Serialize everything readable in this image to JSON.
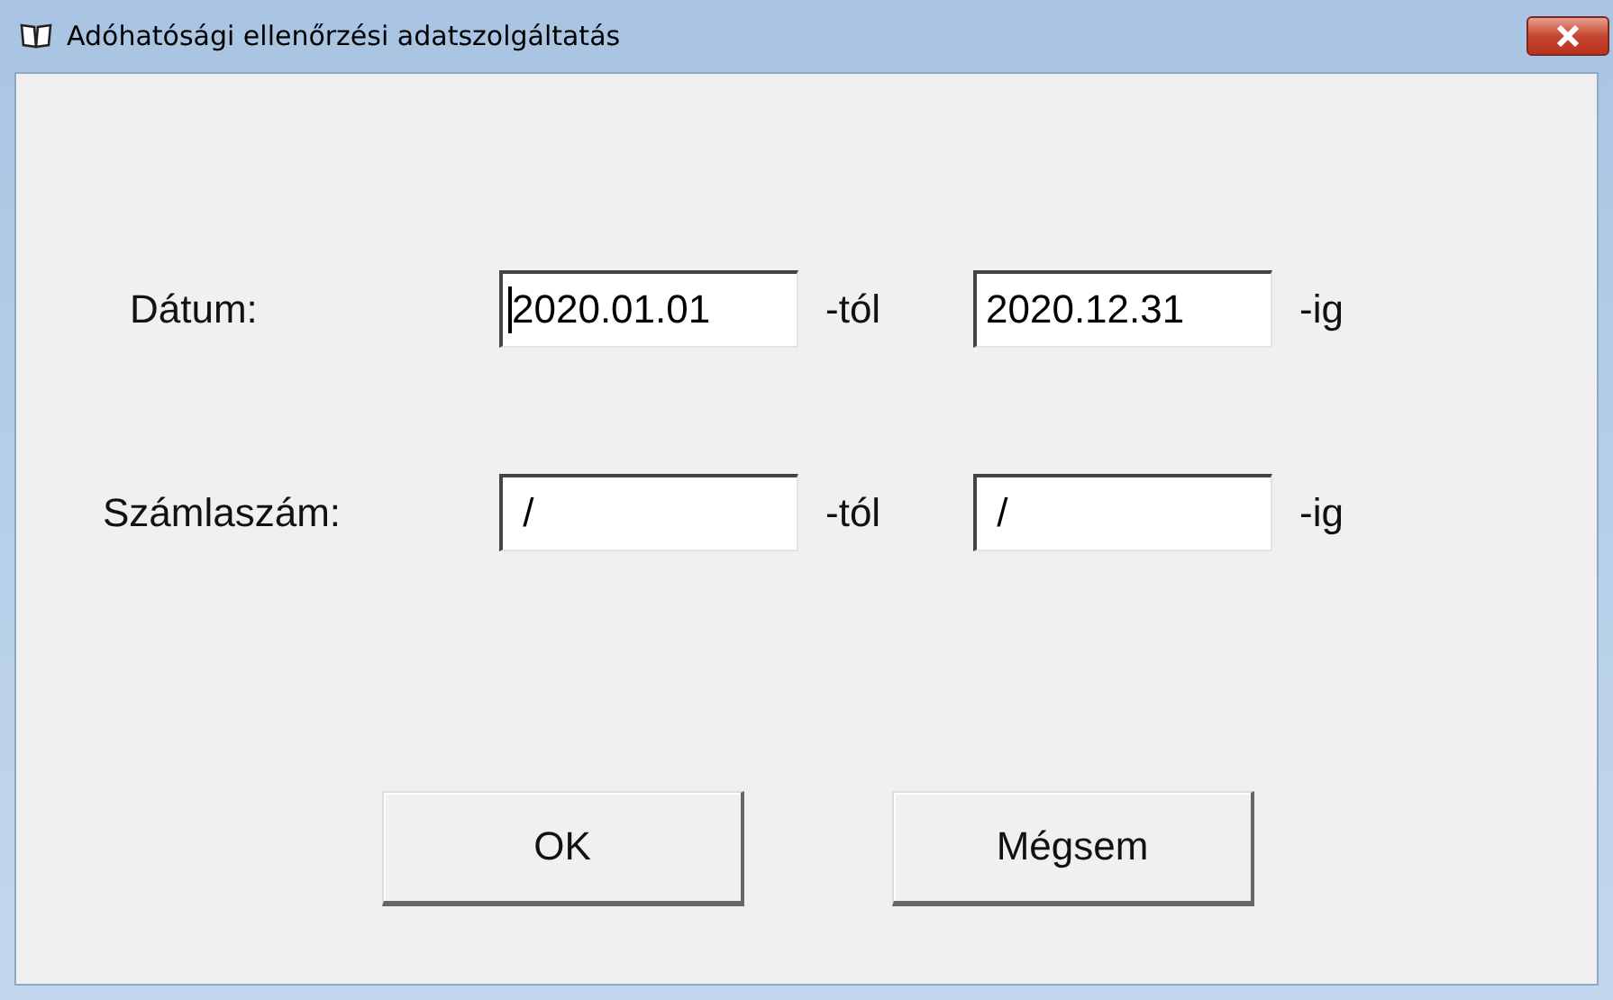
{
  "window": {
    "title": "Adóhatósági ellenőrzési adatszolgáltatás"
  },
  "rows": [
    {
      "label": "Dátum:",
      "from": {
        "value": "2020.01.01",
        "focused": true
      },
      "from_suffix": "-tól",
      "to": {
        "value": "2020.12.31",
        "focused": false
      },
      "to_suffix": "-ig"
    },
    {
      "label": "Számlaszám:",
      "from": {
        "value": " /",
        "focused": false
      },
      "from_suffix": "-tól",
      "to": {
        "value": " /",
        "focused": false
      },
      "to_suffix": "-ig"
    }
  ],
  "buttons": [
    "OK",
    "Mégsem"
  ]
}
